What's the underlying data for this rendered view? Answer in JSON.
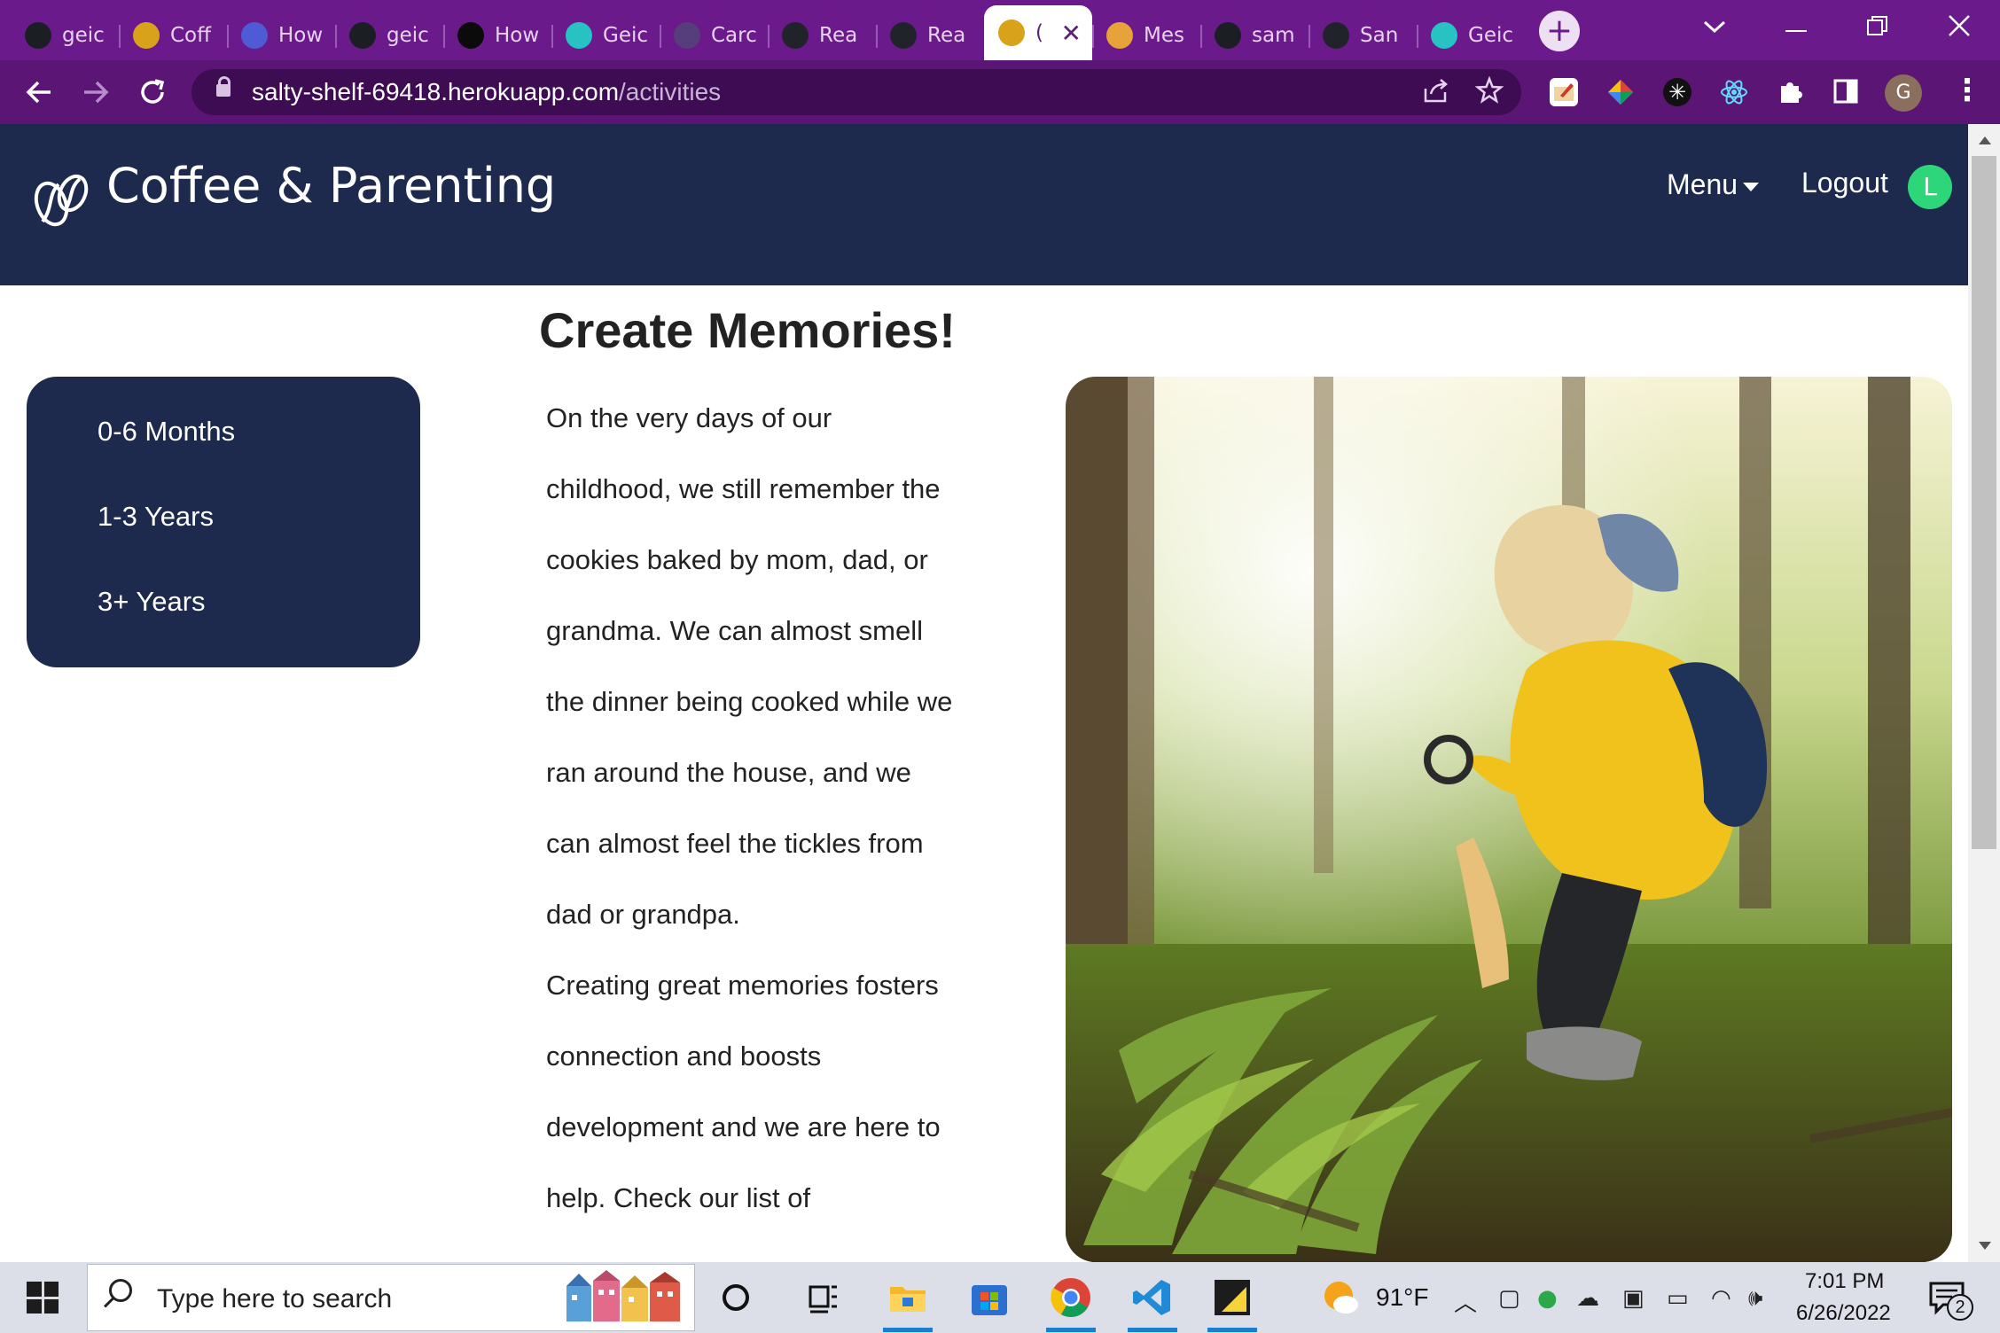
{
  "browser": {
    "tabs": [
      {
        "label": "geic",
        "icon": "github-icon",
        "color": "#1b1f23"
      },
      {
        "label": "Coff",
        "icon": "coffee-cup-icon",
        "color": "#d9a21b"
      },
      {
        "label": "How",
        "icon": "u-logo-icon",
        "color": "#4f5bd5"
      },
      {
        "label": "geic",
        "icon": "github-icon",
        "color": "#1b1f23"
      },
      {
        "label": "How",
        "icon": "lambda-icon",
        "color": "#0b0b0b"
      },
      {
        "label": "Geic",
        "icon": "code-icon",
        "color": "#27c2c2"
      },
      {
        "label": "Carc",
        "icon": "bootstrap-icon",
        "color": "#563d7c"
      },
      {
        "label": "Rea",
        "icon": "react-icon",
        "color": "#20232a"
      },
      {
        "label": "Rea",
        "icon": "react-icon",
        "color": "#20232a"
      },
      {
        "label": "(",
        "icon": "coffee-cup-icon",
        "color": "#d9a21b",
        "active": true
      },
      {
        "label": "Mes",
        "icon": "diamond-icon",
        "color": "#e8a23a"
      },
      {
        "label": "sam",
        "icon": "github-icon",
        "color": "#1b1f23"
      },
      {
        "label": "San",
        "icon": "react-icon",
        "color": "#20232a"
      },
      {
        "label": "Geic",
        "icon": "code-icon",
        "color": "#27c2c2"
      }
    ],
    "close_tab_glyph": "✕",
    "new_tab_glyph": "+",
    "url_host": "salty-shelf-69418.herokuapp.com",
    "url_path": "/activities",
    "accent": "#6b1a8c"
  },
  "app": {
    "brand": "Coffee & Parenting",
    "menu_label": "Menu",
    "logout_label": "Logout",
    "user_initial": "L",
    "header_color": "#1d2a4d",
    "avatar_color": "#2ed67a"
  },
  "sidebar": {
    "items": [
      {
        "label": "0-6 Months"
      },
      {
        "label": "1-3 Years"
      },
      {
        "label": "3+ Years"
      }
    ]
  },
  "content": {
    "title": "Create Memories!",
    "paragraphs": [
      "On the very days of our childhood, we still remember the cookies baked by mom, dad, or grandma. We can almost smell the dinner being cooked while we ran around the house, and we can almost feel the tickles from dad or grandpa.",
      "Creating great memories fosters connection and boosts development and we are here to help. Check our list of"
    ],
    "image": "child-with-magnifying-glass-in-forest"
  },
  "taskbar": {
    "search_placeholder": "Type here to search",
    "weather": "91°F",
    "time": "7:01 PM",
    "date": "6/26/2022",
    "notifications": "2"
  }
}
